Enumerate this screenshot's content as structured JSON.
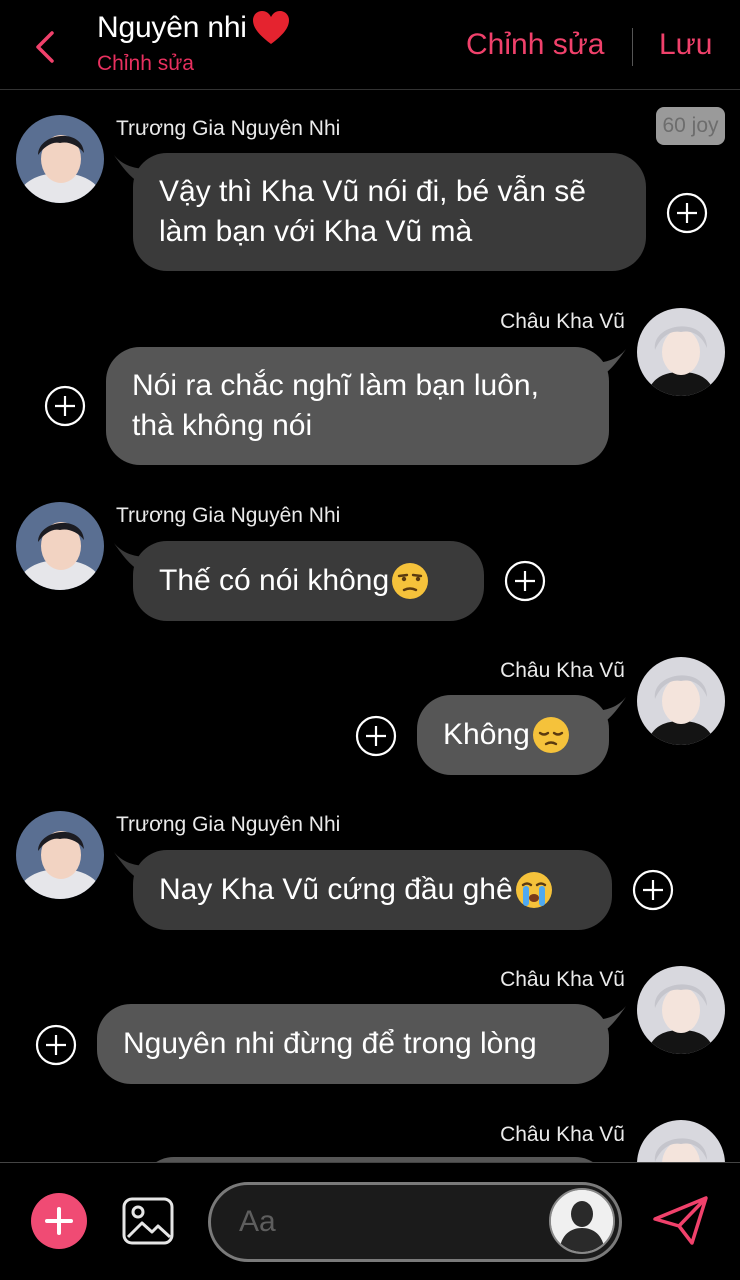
{
  "header": {
    "title": "Nguyên nhi",
    "subtitle": "Chỉnh sửa",
    "edit_label": "Chỉnh sửa",
    "save_label": "Lưu"
  },
  "badge": {
    "joy": "60 joy"
  },
  "messages": [
    {
      "sender": "Trương Gia Nguyên Nhi",
      "side": "left",
      "lines": [
        "Vậy thì Kha Vũ nói đi, bé vẫn sẽ",
        "làm bạn với Kha Vũ mà"
      ]
    },
    {
      "sender": "Châu Kha Vũ",
      "side": "right",
      "lines": [
        "Nói ra chắc nghĩ làm bạn luôn,",
        "thà không nói"
      ]
    },
    {
      "sender": "Trương Gia Nguyên Nhi",
      "side": "left",
      "text": "Thế có nói không",
      "emoji": "unamused-face"
    },
    {
      "sender": "Châu Kha Vũ",
      "side": "right",
      "text": "Không",
      "emoji": "pensive-face"
    },
    {
      "sender": "Trương Gia Nguyên Nhi",
      "side": "left",
      "text": "Nay Kha Vũ cứng đầu ghê",
      "emoji": "loudly-crying-face"
    },
    {
      "sender": "Châu Kha Vũ",
      "side": "right",
      "text": "Nguyên nhi đừng để trong lòng"
    },
    {
      "sender": "Châu Kha Vũ",
      "side": "right",
      "text": ""
    }
  ],
  "footer": {
    "input_placeholder": "Aa"
  },
  "colors": {
    "accent": "#f0416b",
    "incoming_bubble": "#3a3a3a",
    "outgoing_bubble": "#565656"
  }
}
